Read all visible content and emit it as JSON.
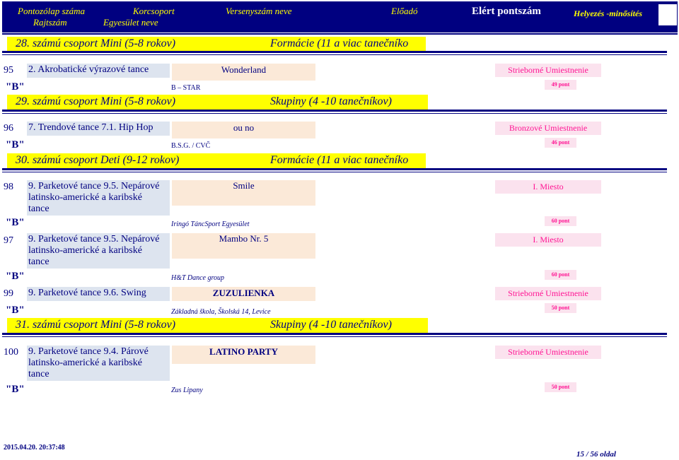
{
  "header": {
    "col1a": "Pontozólap száma",
    "col1b": "Rajtszám",
    "col2a": "Korcsoport",
    "col2b": "Egyesület neve",
    "col3": "Versenyszám neve",
    "col4": "Előadó",
    "col5": "Elért pontszám",
    "col6": "Helyezés -minősítés"
  },
  "categories": [
    {
      "label": "28. számú csoport  Mini (5-8 rokov)",
      "type": "Formácie (11 a viac tanečníko"
    },
    {
      "label": "29. számú csoport  Mini (5-8 rokov)",
      "type": "Skupiny (4 -10 tanečníkov)"
    },
    {
      "label": "30. számú csoport  Deti (9-12 rokov)",
      "type": "Formácie (11 a viac tanečníko"
    },
    {
      "label": "31. számú csoport  Mini (5-8 rokov)",
      "type": "Skupiny (4 -10 tanečníkov)"
    }
  ],
  "entries": [
    {
      "num": "95",
      "dance": "2. Akrobatické výrazové tance",
      "title": "Wonderland",
      "medal": "Strieborné Umiestnenie",
      "grade": "\"B\"",
      "club": "B – STAR",
      "points": "49 pont"
    },
    {
      "num": "96",
      "dance": "7. Trendové tance 7.1. Hip Hop",
      "title": "ou no",
      "medal": "Bronzové Umiestnenie",
      "grade": "\"B\"",
      "club": "B.S.G. / CVČ",
      "points": "46 pont"
    },
    {
      "num": "98",
      "dance_lines": [
        "9. Parketové tance 9.5. Nepárové",
        "latinsko-americké a karibské",
        "tance"
      ],
      "title": "Smile",
      "medal": "I. Miesto",
      "grade": "\"B\"",
      "club": "Iringó TáncSport Egyesület",
      "points": "60 pont"
    },
    {
      "num": "97",
      "dance_lines": [
        "9. Parketové tance 9.5. Nepárové",
        "latinsko-americké a karibské",
        "tance"
      ],
      "title": "Mambo Nr. 5",
      "medal": "I. Miesto",
      "grade": "\"B\"",
      "club": "H&T Dance group",
      "points": "60 pont"
    },
    {
      "num": "99",
      "dance": "9. Parketové tance 9.6. Swing",
      "title": "ZUZULIENKA",
      "medal": "Strieborné Umiestnenie",
      "grade": "\"B\"",
      "club": "Základná škola, Školská 14, Levice",
      "points": "50 pont"
    },
    {
      "num": "100",
      "dance_lines": [
        "9. Parketové tance 9.4. Párové",
        "latinsko-americké a karibské",
        "tance"
      ],
      "title": "LATINO PARTY",
      "medal": "Strieborné Umiestnenie",
      "grade": "\"B\"",
      "club": "Zus Lipany",
      "points": "50 pont"
    }
  ],
  "footer": {
    "timestamp": "2015.04.20. 20:37:48",
    "page": "15 / 56 oldal"
  }
}
